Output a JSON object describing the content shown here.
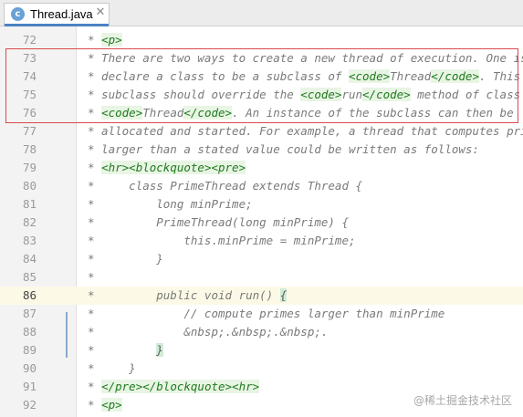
{
  "tab": {
    "title": "Thread.java",
    "icon_letter": "c",
    "close_glyph": "✕",
    "icon": "java-class-icon"
  },
  "editor": {
    "current_line": 86,
    "lines": [
      {
        "number": "72",
        "parts": [
          {
            "t": "* "
          },
          {
            "t": "<p>",
            "c": "tag"
          }
        ]
      },
      {
        "number": "73",
        "parts": [
          {
            "t": "* There are two ways to create a new thread of execution. One is to"
          }
        ]
      },
      {
        "number": "74",
        "parts": [
          {
            "t": "* declare a class to be a subclass of "
          },
          {
            "t": "<code>",
            "c": "tag"
          },
          {
            "t": "Thread"
          },
          {
            "t": "</code>",
            "c": "tag"
          },
          {
            "t": ". This"
          }
        ]
      },
      {
        "number": "75",
        "parts": [
          {
            "t": "* subclass should override the "
          },
          {
            "t": "<code>",
            "c": "tag"
          },
          {
            "t": "run"
          },
          {
            "t": "</code>",
            "c": "tag"
          },
          {
            "t": " method of class"
          }
        ]
      },
      {
        "number": "76",
        "parts": [
          {
            "t": "* "
          },
          {
            "t": "<code>",
            "c": "tag"
          },
          {
            "t": "Thread"
          },
          {
            "t": "</code>",
            "c": "tag"
          },
          {
            "t": ". An instance of the subclass can then be"
          }
        ]
      },
      {
        "number": "77",
        "parts": [
          {
            "t": "* allocated and started. For example, a thread that computes primes"
          }
        ]
      },
      {
        "number": "78",
        "parts": [
          {
            "t": "* larger than a stated value could be written as follows:"
          }
        ]
      },
      {
        "number": "79",
        "parts": [
          {
            "t": "* "
          },
          {
            "t": "<hr>",
            "c": "tag"
          },
          {
            "t": "<blockquote>",
            "c": "tag"
          },
          {
            "t": "<pre>",
            "c": "tag"
          }
        ]
      },
      {
        "number": "80",
        "parts": [
          {
            "t": "*     class PrimeThread extends Thread {"
          }
        ]
      },
      {
        "number": "81",
        "parts": [
          {
            "t": "*         long minPrime;"
          }
        ]
      },
      {
        "number": "82",
        "parts": [
          {
            "t": "*         PrimeThread(long minPrime) {"
          }
        ]
      },
      {
        "number": "83",
        "parts": [
          {
            "t": "*             this.minPrime = minPrime;"
          }
        ]
      },
      {
        "number": "84",
        "parts": [
          {
            "t": "*         }"
          }
        ]
      },
      {
        "number": "85",
        "parts": [
          {
            "t": "*"
          }
        ]
      },
      {
        "number": "86",
        "parts": [
          {
            "t": "*         public void run() "
          },
          {
            "t": "{",
            "c": "brace"
          }
        ]
      },
      {
        "number": "87",
        "parts": [
          {
            "t": "*             // compute primes larger than minPrime"
          }
        ]
      },
      {
        "number": "88",
        "parts": [
          {
            "t": "*             &nbsp;.&nbsp;.&nbsp;."
          }
        ]
      },
      {
        "number": "89",
        "parts": [
          {
            "t": "*         "
          },
          {
            "t": "}",
            "c": "brace"
          }
        ]
      },
      {
        "number": "90",
        "parts": [
          {
            "t": "*     }"
          }
        ]
      },
      {
        "number": "91",
        "parts": [
          {
            "t": "* "
          },
          {
            "t": "</pre>",
            "c": "tag"
          },
          {
            "t": "</blockquote>",
            "c": "tag"
          },
          {
            "t": "<hr>",
            "c": "tag"
          }
        ]
      },
      {
        "number": "92",
        "parts": [
          {
            "t": "* "
          },
          {
            "t": "<p>",
            "c": "tag"
          }
        ]
      }
    ]
  },
  "watermark": {
    "text": "@稀土掘金技术社区"
  }
}
